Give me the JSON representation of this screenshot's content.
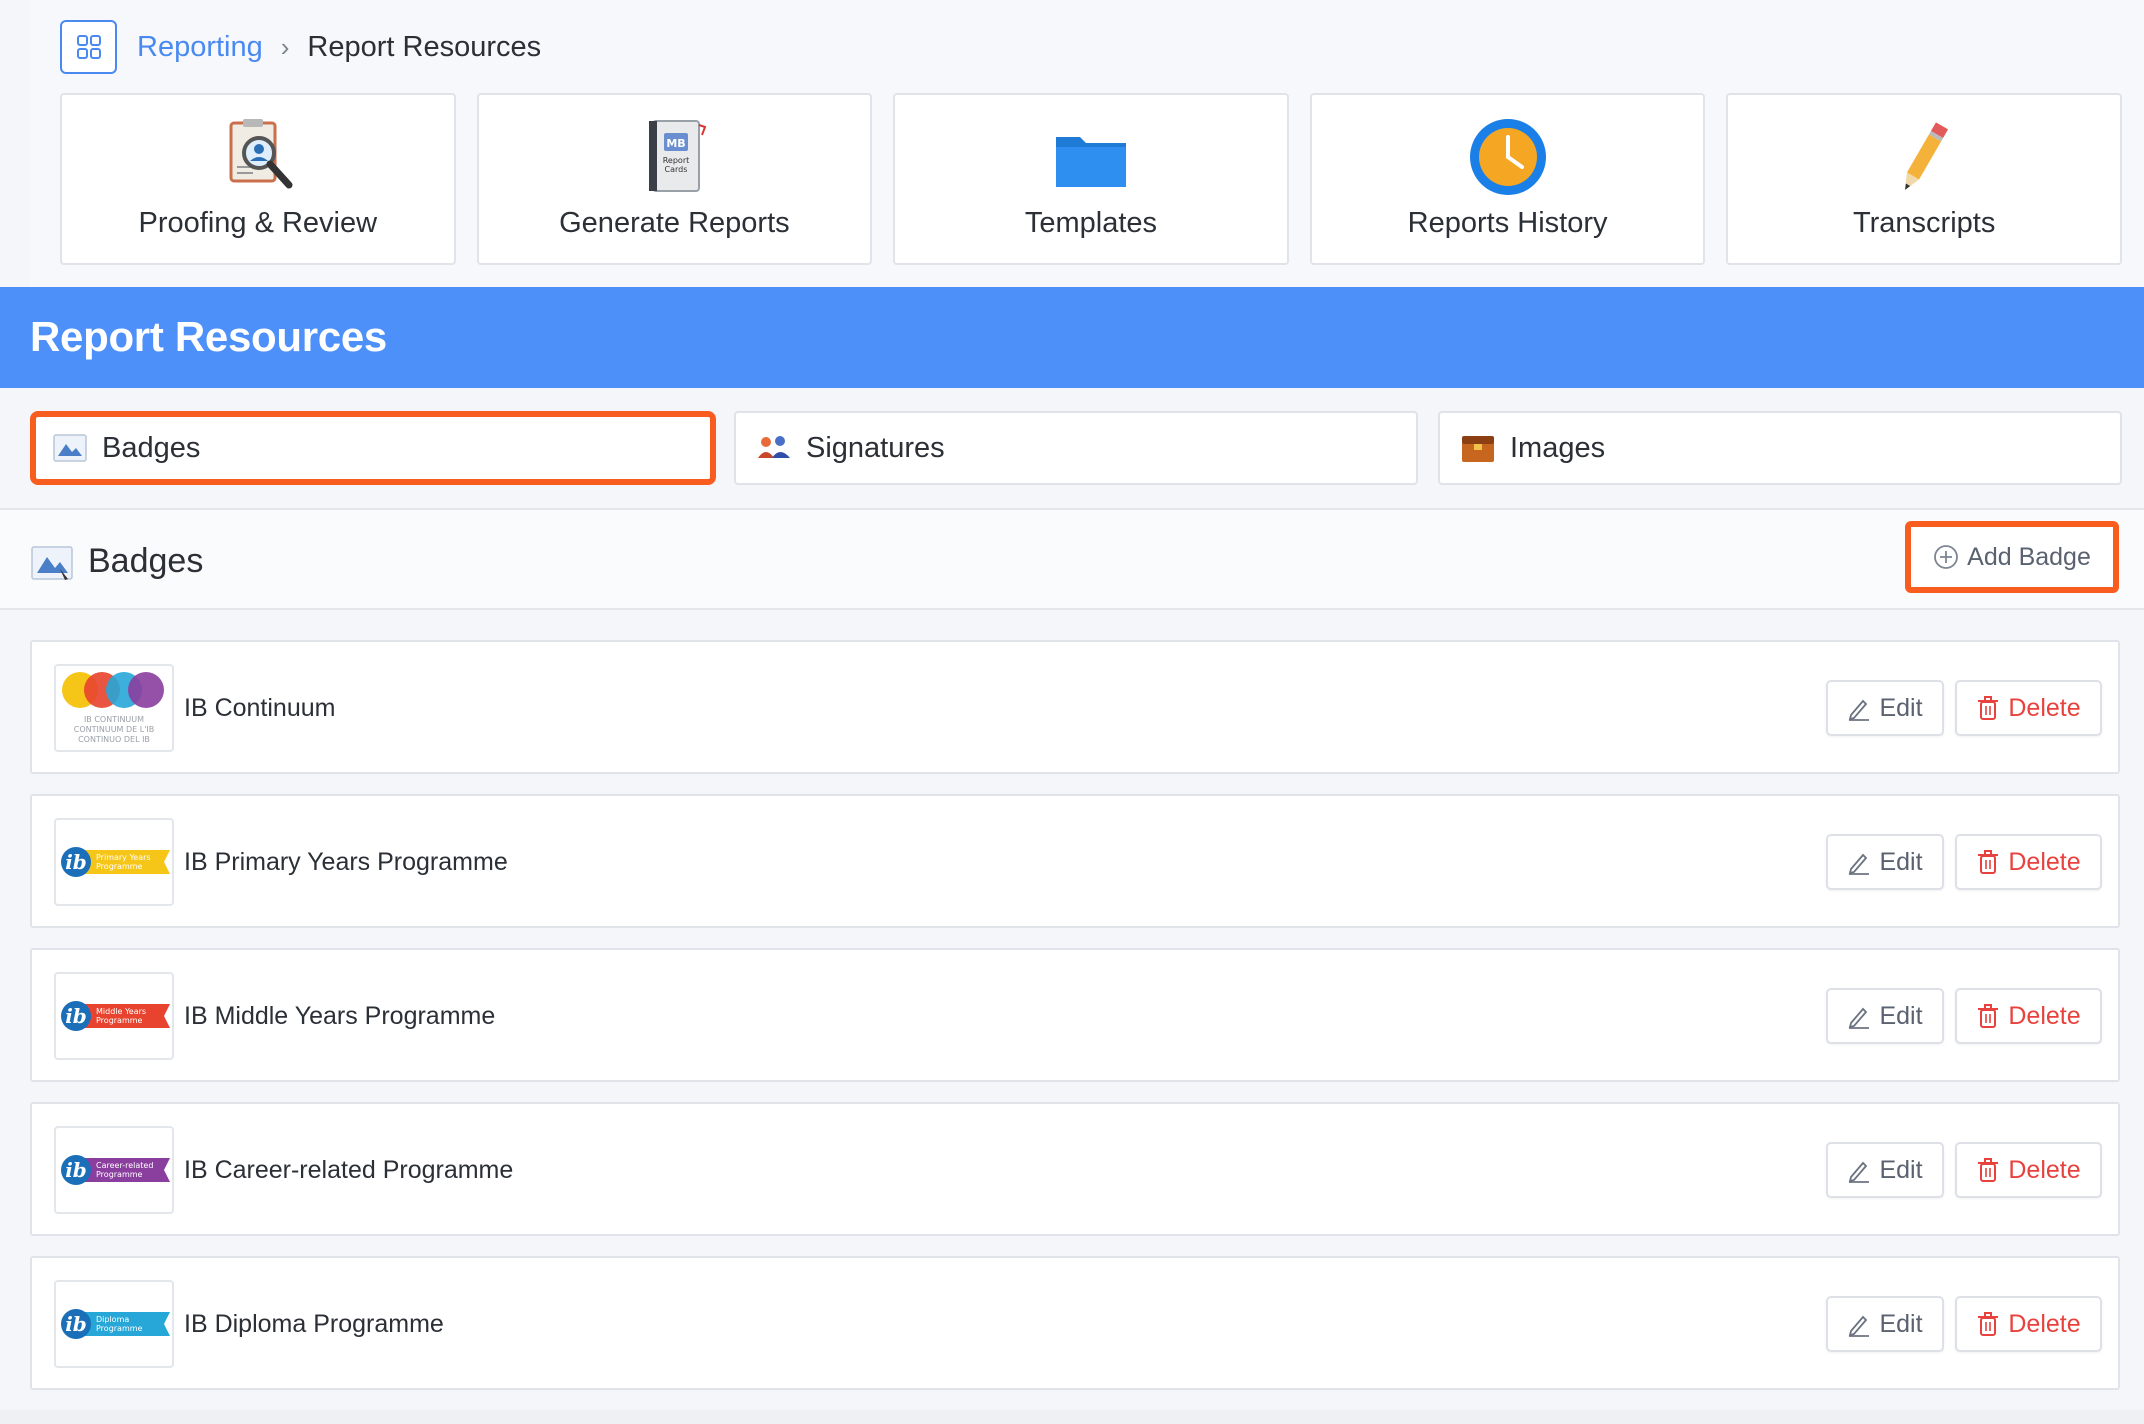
{
  "breadcrumb": {
    "home_icon": "grid-icon",
    "parent": "Reporting",
    "separator": "›",
    "current": "Report Resources"
  },
  "tiles": [
    {
      "label": "Proofing & Review",
      "icon": "proofing-magnifier-icon"
    },
    {
      "label": "Generate Reports",
      "icon": "report-cards-notebook-icon"
    },
    {
      "label": "Templates",
      "icon": "folder-icon"
    },
    {
      "label": "Reports History",
      "icon": "clock-icon"
    },
    {
      "label": "Transcripts",
      "icon": "pencil-icon"
    }
  ],
  "banner": {
    "title": "Report Resources"
  },
  "subtabs": [
    {
      "label": "Badges",
      "icon": "badge-image-icon",
      "active": true
    },
    {
      "label": "Signatures",
      "icon": "people-signature-icon",
      "active": false
    },
    {
      "label": "Images",
      "icon": "image-chest-icon",
      "active": false
    }
  ],
  "section": {
    "title": "Badges",
    "add_button": "Add Badge"
  },
  "badges": [
    {
      "name": "IB Continuum",
      "thumb_text": [
        "IB CONTINUUM",
        "CONTINUUM DE L'IB",
        "CONTINUO DEL IB"
      ]
    },
    {
      "name": "IB Primary Years Programme",
      "thumb_text": [
        "Primary Years",
        "Programme"
      ],
      "color": "#f5c518"
    },
    {
      "name": "IB Middle Years Programme",
      "thumb_text": [
        "Middle Years",
        "Programme"
      ],
      "color": "#e8432e"
    },
    {
      "name": "IB Career-related Programme",
      "thumb_text": [
        "Career-related",
        "Programme"
      ],
      "color": "#8a3e9e"
    },
    {
      "name": "IB Diploma Programme",
      "thumb_text": [
        "Diploma",
        "Programme"
      ],
      "color": "#27a6d8"
    }
  ],
  "row_actions": {
    "edit": "Edit",
    "delete": "Delete"
  },
  "colors": {
    "accent": "#4d90fa",
    "highlight": "#f85c1e",
    "danger": "#e8423e"
  }
}
